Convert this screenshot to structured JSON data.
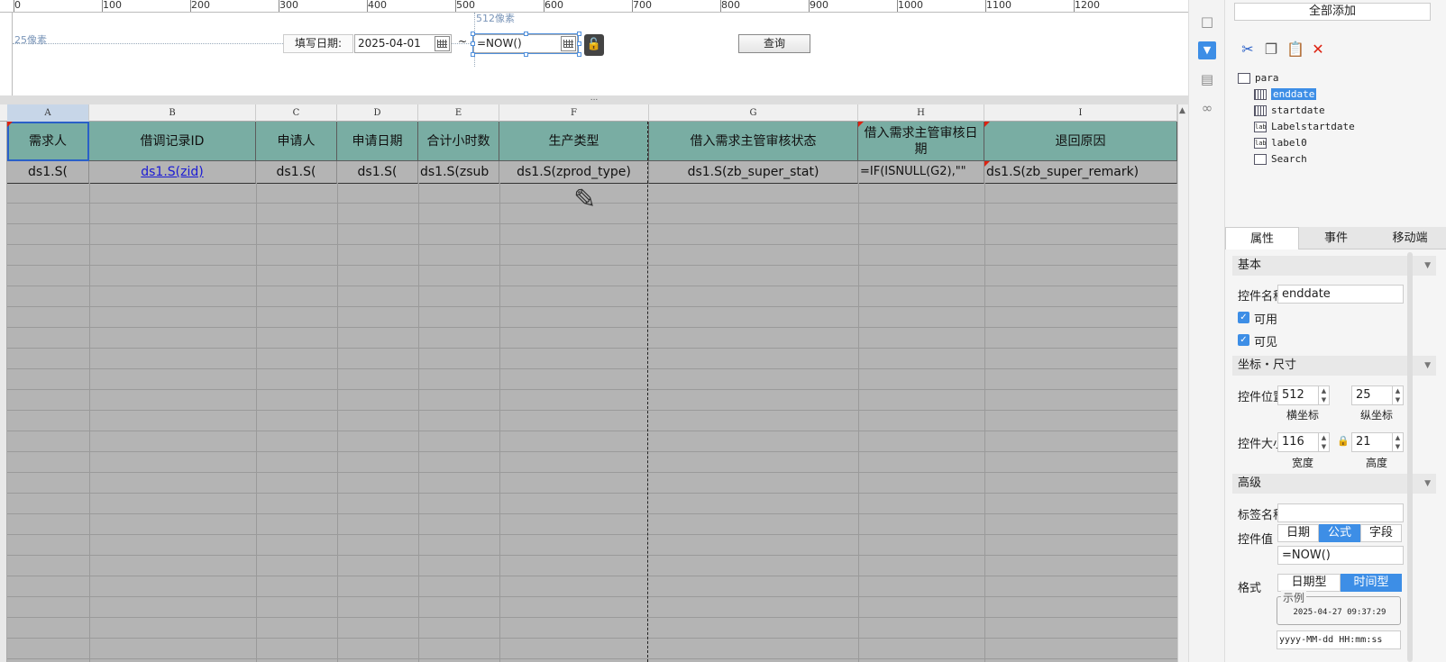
{
  "ruler": {
    "labels": [
      "0",
      "100",
      "200",
      "300",
      "400",
      "500",
      "600",
      "700",
      "800",
      "900",
      "1000",
      "1100",
      "1200"
    ]
  },
  "param_panel": {
    "px_y_note": "25像素",
    "px_x_note": "512像素",
    "date_label": "填写日期:",
    "start_date_value": "2025-04-01",
    "tilde": "~",
    "end_date_value": "=NOW()",
    "query_button": "查询"
  },
  "splitter_label": "...",
  "sheet": {
    "column_letters": [
      "A",
      "B",
      "C",
      "D",
      "E",
      "F",
      "G",
      "H",
      "I"
    ],
    "header_row": [
      "需求人",
      "借调记录ID",
      "申请人",
      "申请日期",
      "合计小时数",
      "生产类型",
      "借入需求主管审核状态",
      "借入需求主管审核日期",
      "退回原因"
    ],
    "data_row": [
      "ds1.S(",
      "ds1.S(zid)",
      "ds1.S(",
      "ds1.S(",
      "ds1.S(zsub",
      "ds1.S(zprod_type)",
      "ds1.S(zb_super_stat)",
      "=IF(ISNULL(G2),\"\"",
      "ds1.S(zb_super_remark)"
    ]
  },
  "right_panel": {
    "add_all_button": "全部添加",
    "tree": [
      {
        "label": "para",
        "icon": "form-icon"
      },
      {
        "label": "enddate",
        "icon": "date-control-icon",
        "selected": true
      },
      {
        "label": "startdate",
        "icon": "date-control-icon"
      },
      {
        "label": "Labelstartdate",
        "icon": "label-icon"
      },
      {
        "label": "label0",
        "icon": "label-icon"
      },
      {
        "label": "Search",
        "icon": "button-icon"
      }
    ],
    "tabs": [
      "属性",
      "事件",
      "移动端"
    ],
    "sections": {
      "basic": "基本",
      "position_size": "坐标・尺寸",
      "advanced": "高级"
    },
    "props": {
      "control_name_label": "控件名称",
      "control_name_value": "enddate",
      "enabled_label": "可用",
      "visible_label": "可见",
      "position_label": "控件位置",
      "x_value": "512",
      "y_value": "25",
      "x_caption": "横坐标",
      "y_caption": "纵坐标",
      "size_label": "控件大小",
      "width_value": "116",
      "height_value": "21",
      "width_caption": "宽度",
      "height_caption": "高度",
      "tag_name_label": "标签名称",
      "tag_name_value": "",
      "control_value_label": "控件值",
      "value_modes": [
        "日期",
        "公式",
        "字段"
      ],
      "value_formula": "=NOW()",
      "format_label": "格式",
      "format_modes": [
        "日期型",
        "时间型"
      ],
      "example_legend": "示例",
      "example_value": "2025-04-27 09:37:29",
      "format_pattern": "yyyy-MM-dd HH:mm:ss"
    },
    "colors": {
      "accent": "#3d8ee6",
      "header_fill": "#79ada3",
      "sheet_fill": "#b4b4b4"
    }
  }
}
